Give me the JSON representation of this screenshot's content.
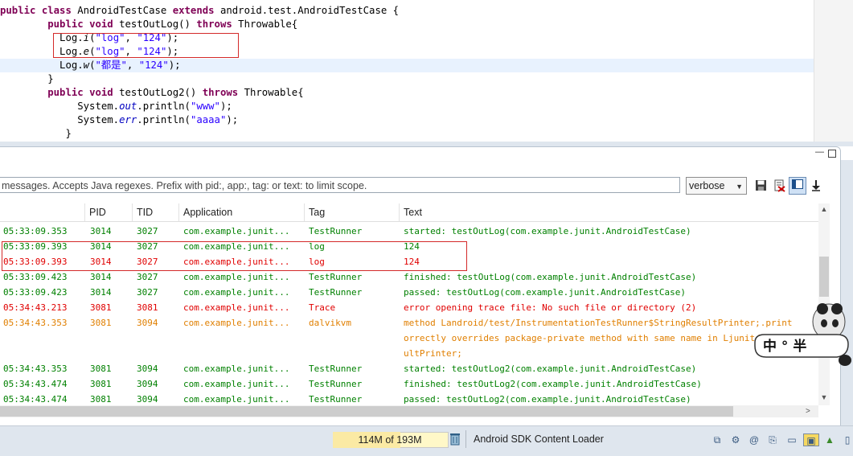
{
  "editor": {
    "lines": [
      {
        "indent": "",
        "parts": [
          [
            "kw",
            "public "
          ],
          [
            "kw",
            "class "
          ],
          [
            "",
            "AndroidTestCase "
          ],
          [
            "kw",
            "extends "
          ],
          [
            "",
            "android.test.AndroidTestCase {"
          ]
        ]
      },
      {
        "indent": "        ",
        "parts": [
          [
            "kw",
            "public "
          ],
          [
            "kw",
            "void "
          ],
          [
            "",
            "testOutLog() "
          ],
          [
            "kw",
            "throws "
          ],
          [
            "",
            "Throwable{"
          ]
        ]
      },
      {
        "indent": "          ",
        "parts": [
          [
            "",
            "Log."
          ],
          [
            "itc",
            "i"
          ],
          [
            "",
            "("
          ],
          [
            "str",
            "\"log\""
          ],
          [
            "",
            ", "
          ],
          [
            "str",
            "\"124\""
          ],
          [
            "",
            ");"
          ]
        ]
      },
      {
        "indent": "          ",
        "parts": [
          [
            "",
            "Log."
          ],
          [
            "itc",
            "e"
          ],
          [
            "",
            "("
          ],
          [
            "str",
            "\"log\""
          ],
          [
            "",
            ", "
          ],
          [
            "str",
            "\"124\""
          ],
          [
            "",
            ");"
          ]
        ]
      },
      {
        "indent": "          ",
        "parts": [
          [
            "",
            "Log."
          ],
          [
            "itc",
            "w"
          ],
          [
            "",
            "("
          ],
          [
            "str",
            "\"都是\""
          ],
          [
            "",
            ", "
          ],
          [
            "str",
            "\"124\""
          ],
          [
            "",
            ");"
          ]
        ]
      },
      {
        "indent": "        ",
        "parts": [
          [
            "",
            "}"
          ]
        ]
      },
      {
        "indent": "        ",
        "parts": [
          [
            "kw",
            "public "
          ],
          [
            "kw",
            "void "
          ],
          [
            "",
            "testOutLog2() "
          ],
          [
            "kw",
            "throws "
          ],
          [
            "",
            "Throwable{"
          ]
        ]
      },
      {
        "indent": "             ",
        "parts": [
          [
            "",
            "System."
          ],
          [
            "fld",
            "out"
          ],
          [
            "",
            ".println("
          ],
          [
            "str",
            "\"www\""
          ],
          [
            "",
            ");"
          ]
        ]
      },
      {
        "indent": "             ",
        "parts": [
          [
            "",
            "System."
          ],
          [
            "fld",
            "err"
          ],
          [
            "",
            ".println("
          ],
          [
            "str",
            "\"aaaa\""
          ],
          [
            "",
            ");"
          ]
        ]
      },
      {
        "indent": "           ",
        "parts": [
          [
            "",
            "}"
          ]
        ]
      }
    ]
  },
  "logcat": {
    "filter_placeholder": "messages. Accepts Java regexes. Prefix with pid:, app:, tag: or text: to limit scope.",
    "level": "verbose",
    "columns": [
      "PID",
      "TID",
      "Application",
      "Tag",
      "Text"
    ],
    "rows": [
      {
        "level": "I",
        "time": "05:33:09.353",
        "pid": "3014",
        "tid": "3027",
        "app": "com.example.junit...",
        "tag": "TestRunner",
        "text": "started: testOutLog(com.example.junit.AndroidTestCase)"
      },
      {
        "level": "I",
        "time": "05:33:09.393",
        "pid": "3014",
        "tid": "3027",
        "app": "com.example.junit...",
        "tag": "log",
        "text": "124"
      },
      {
        "level": "E",
        "time": "05:33:09.393",
        "pid": "3014",
        "tid": "3027",
        "app": "com.example.junit...",
        "tag": "log",
        "text": "124"
      },
      {
        "level": "I",
        "time": "05:33:09.423",
        "pid": "3014",
        "tid": "3027",
        "app": "com.example.junit...",
        "tag": "TestRunner",
        "text": "finished: testOutLog(com.example.junit.AndroidTestCase)"
      },
      {
        "level": "I",
        "time": "05:33:09.423",
        "pid": "3014",
        "tid": "3027",
        "app": "com.example.junit...",
        "tag": "TestRunner",
        "text": "passed: testOutLog(com.example.junit.AndroidTestCase)"
      },
      {
        "level": "E",
        "time": "05:34:43.213",
        "pid": "3081",
        "tid": "3081",
        "app": "com.example.junit...",
        "tag": "Trace",
        "text": "error opening trace file: No such file or directory (2)"
      },
      {
        "level": "W",
        "time": "05:34:43.353",
        "pid": "3081",
        "tid": "3094",
        "app": "com.example.junit...",
        "tag": "dalvikvm",
        "text": "method Landroid/test/InstrumentationTestRunner$StringResultPrinter;.print"
      },
      {
        "level": "W",
        "time": "",
        "pid": "",
        "tid": "",
        "app": "",
        "tag": "",
        "text": "orrectly overrides package-private method with same name in Ljunit/"
      },
      {
        "level": "W",
        "time": "",
        "pid": "",
        "tid": "",
        "app": "",
        "tag": "",
        "text": "ultPrinter;"
      },
      {
        "level": "I",
        "time": "05:34:43.353",
        "pid": "3081",
        "tid": "3094",
        "app": "com.example.junit...",
        "tag": "TestRunner",
        "text": "started: testOutLog2(com.example.junit.AndroidTestCase)"
      },
      {
        "level": "I",
        "time": "05:34:43.474",
        "pid": "3081",
        "tid": "3094",
        "app": "com.example.junit...",
        "tag": "TestRunner",
        "text": "finished: testOutLog2(com.example.junit.AndroidTestCase)"
      },
      {
        "level": "I",
        "time": "05:34:43.474",
        "pid": "3081",
        "tid": "3094",
        "app": "com.example.junit...",
        "tag": "TestRunner",
        "text": "passed: testOutLog2(com.example.junit.AndroidTestCase)"
      }
    ]
  },
  "status": {
    "heap": "114M of 193M",
    "heap_used_fraction": 0.59,
    "task": "Android SDK Content Loader"
  },
  "sticker": {
    "text": "中 ° 半"
  },
  "icons": {
    "save": "save-icon",
    "clear": "clear-log-icon",
    "toggle": "toggle-filter-icon",
    "scroll_lock": "scroll-lock-icon",
    "gc": "trash-icon"
  },
  "colors": {
    "info": "#008000",
    "error": "#e00000",
    "warn": "#e07f00",
    "highlight_box": "#d42a2a"
  }
}
